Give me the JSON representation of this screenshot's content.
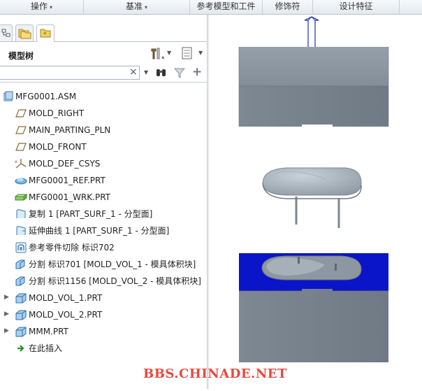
{
  "ribbon": {
    "groups": [
      {
        "label": "操作",
        "has_menu": true
      },
      {
        "label": "基准",
        "has_menu": true
      },
      {
        "label": "参考模型和工件",
        "has_menu": false
      },
      {
        "label": "修饰符",
        "has_menu": false
      },
      {
        "label": "设计特征",
        "has_menu": false
      }
    ]
  },
  "panel": {
    "tabs": [
      "model-tree-tab-icon",
      "folder-browser-tab-icon",
      "favorites-tab-icon"
    ],
    "title": "模型树",
    "search_value": ""
  },
  "tree": {
    "items": [
      {
        "label": "MFG0001.ASM",
        "icon": "assembly-icon",
        "expandable": false
      },
      {
        "label": "MOLD_RIGHT",
        "icon": "datum-plane-icon",
        "expandable": false
      },
      {
        "label": "MAIN_PARTING_PLN",
        "icon": "datum-plane-icon",
        "expandable": false
      },
      {
        "label": "MOLD_FRONT",
        "icon": "datum-plane-icon",
        "expandable": false
      },
      {
        "label": "MOLD_DEF_CSYS",
        "icon": "coordinate-system-icon",
        "expandable": false
      },
      {
        "label": "MFG0001_REF.PRT",
        "icon": "reference-part-icon",
        "expandable": false
      },
      {
        "label": "MFG0001_WRK.PRT",
        "icon": "workpiece-icon",
        "expandable": false
      },
      {
        "label": "复制 1 [PART_SURF_1 - 分型面]",
        "icon": "copy-surface-icon",
        "expandable": false
      },
      {
        "label": "延伸曲线 1 [PART_SURF_1 - 分型面]",
        "icon": "extend-surface-icon",
        "expandable": false
      },
      {
        "label": "参考零件切除 标识702",
        "icon": "ref-part-cutout-icon",
        "expandable": false
      },
      {
        "label": "分割 标识701 [MOLD_VOL_1 - 模具体积块]",
        "icon": "split-icon",
        "expandable": false
      },
      {
        "label": "分割 标识1156 [MOLD_VOL_2 - 模具体积块]",
        "icon": "split-icon",
        "expandable": false
      },
      {
        "label": "MOLD_VOL_1.PRT",
        "icon": "part-icon",
        "expandable": true
      },
      {
        "label": "MOLD_VOL_2.PRT",
        "icon": "part-icon",
        "expandable": true
      },
      {
        "label": "MMM.PRT",
        "icon": "part-icon",
        "expandable": true
      },
      {
        "label": "在此插入",
        "icon": "insert-here-arrow-icon",
        "expandable": false
      }
    ]
  },
  "viewport": {
    "watermark": "BBS.CHINADE.NET",
    "colors": {
      "body": "#8a959f",
      "parting_surface": "#0a14c8",
      "watermark": "#e8493f"
    }
  }
}
